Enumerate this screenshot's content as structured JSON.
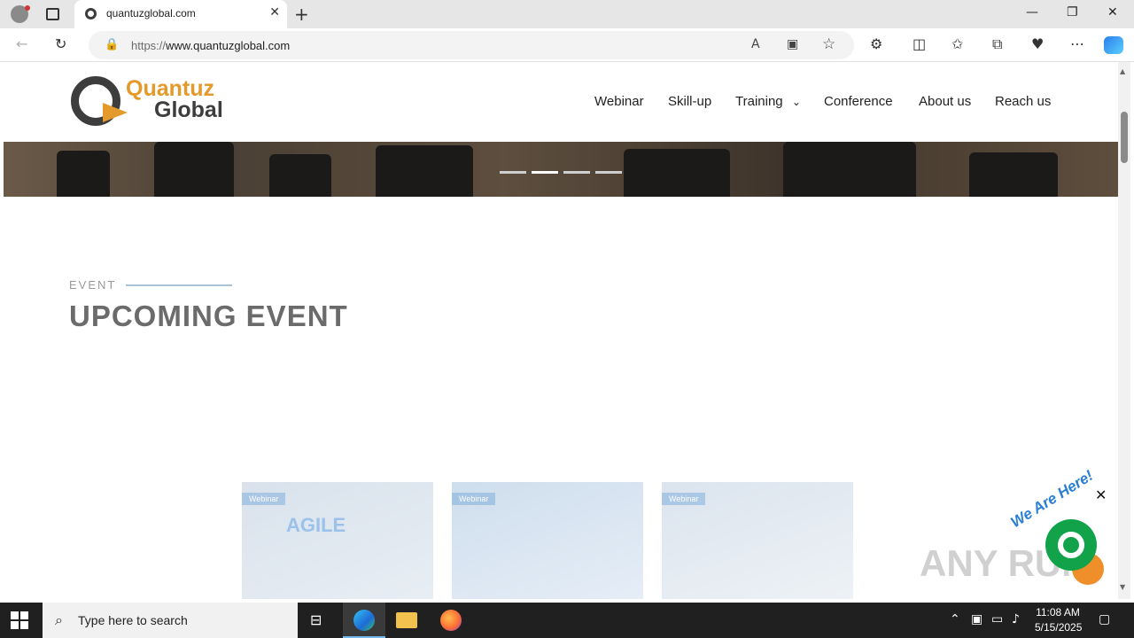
{
  "browser": {
    "tab_title": "quantuzglobal.com",
    "url_scheme": "https://",
    "url_host": "www.quantuzglobal.com"
  },
  "site": {
    "logo_line1": "Quantuz",
    "logo_line2": "Global",
    "nav": [
      "Webinar",
      "Skill-up",
      "Training",
      "Conference",
      "About us",
      "Reach us"
    ]
  },
  "event": {
    "label": "EVENT",
    "title": "UPCOMING EVENT",
    "cards": [
      {
        "badge": "Webinar",
        "art": "AGILE"
      },
      {
        "badge": "Webinar",
        "art": ""
      },
      {
        "badge": "Webinar",
        "art": ""
      }
    ]
  },
  "widget": {
    "tagline": "We Are Here!",
    "watermark": "ANY RUN"
  },
  "taskbar": {
    "search_placeholder": "Type here to search",
    "time": "11:08 AM",
    "date": "5/15/2025"
  },
  "icons": [
    "profile-icon",
    "tab-actions-icon",
    "back-icon",
    "refresh-icon",
    "lock-icon",
    "read-aloud-icon",
    "immersive-reader-icon",
    "favorite-star-icon",
    "extensions-icon",
    "split-screen-icon",
    "favorites-icon",
    "collections-icon",
    "browser-essentials-icon",
    "more-icon",
    "copilot-icon",
    "chevron-down-icon"
  ],
  "colors": {
    "brand_orange": "#e39a2b",
    "brand_dark": "#3d3d3d",
    "chat_green": "#12a34a"
  }
}
